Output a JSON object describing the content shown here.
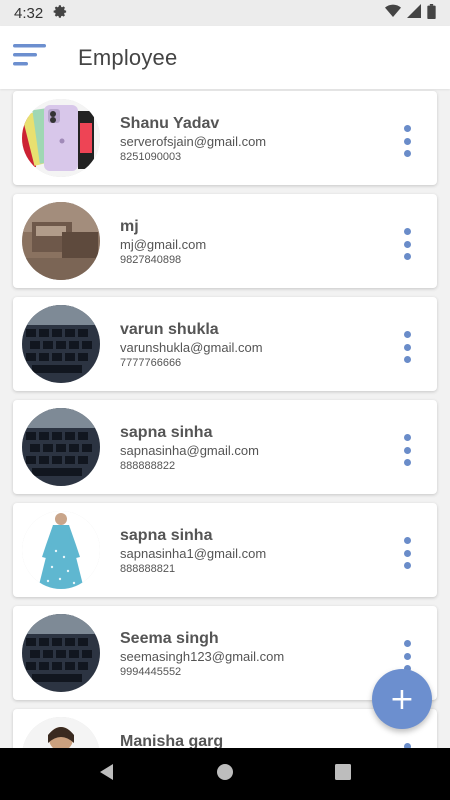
{
  "status_bar": {
    "time": "4:32",
    "icons": [
      "settings-icon",
      "wifi-icon",
      "signal-icon",
      "battery-icon"
    ]
  },
  "app_bar": {
    "title": "Employee",
    "menu_icon": "menu-icon"
  },
  "employees": [
    {
      "name": "Shanu Yadav",
      "email": "serverofsjain@gmail.com",
      "phone": "8251090003",
      "avatar": "phone-photo"
    },
    {
      "name": "mj",
      "email": "mj@gmail.com",
      "phone": "9827840898",
      "avatar": "room-photo"
    },
    {
      "name": "varun shukla",
      "email": "varunshukla@gmail.com",
      "phone": "7777766666",
      "avatar": "keyboard-photo"
    },
    {
      "name": "sapna sinha",
      "email": "sapnasinha@gmail.com",
      "phone": "888888822",
      "avatar": "keyboard-photo"
    },
    {
      "name": "sapna sinha",
      "email": "sapnasinha1@gmail.com",
      "phone": "888888821",
      "avatar": "dress-photo"
    },
    {
      "name": "Seema singh",
      "email": "seemasingh123@gmail.com",
      "phone": "9994445552",
      "avatar": "keyboard-photo"
    },
    {
      "name": "Manisha garg",
      "email": "",
      "phone": "",
      "avatar": "person-photo"
    }
  ],
  "fab": {
    "label": "+",
    "icon": "add-icon"
  },
  "colors": {
    "accent": "#6c8fcf",
    "menu_dots": "#6a8cc9",
    "title_text": "#444444"
  },
  "nav_bar": {
    "icons": [
      "back-icon",
      "home-icon",
      "recents-icon"
    ]
  }
}
